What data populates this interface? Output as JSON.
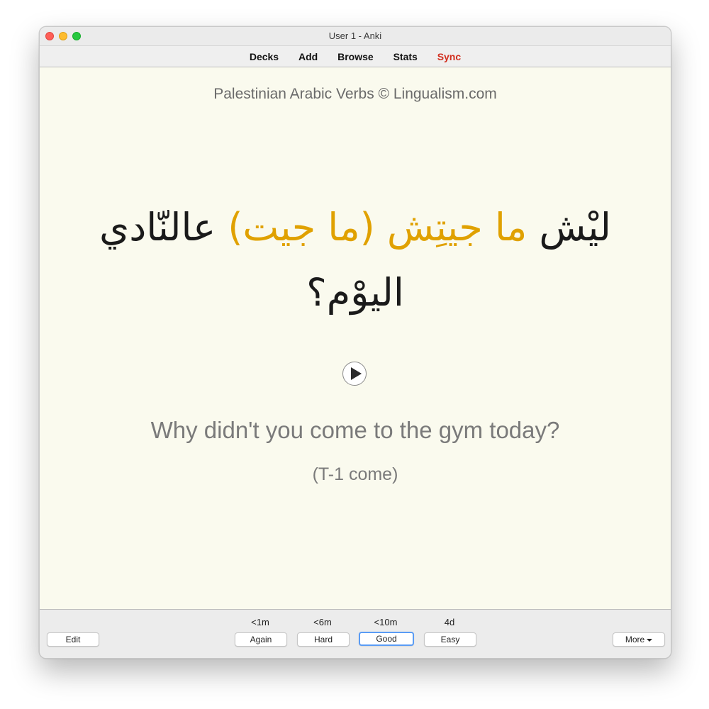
{
  "window": {
    "title": "User 1 - Anki"
  },
  "toolbar": {
    "decks": "Decks",
    "add": "Add",
    "browse": "Browse",
    "stats": "Stats",
    "sync": "Sync",
    "sync_color": "#d22e1e"
  },
  "card": {
    "deck_title": "Palestinian Arabic Verbs © Lingualism.com",
    "arabic_before": "ليْش ",
    "arabic_highlight": "ما جيتِش (ما جيت)",
    "arabic_after": " عالنّادي اليوْم؟",
    "highlight_color": "#e0a100",
    "play_icon": "play-icon",
    "english": "Why didn't you come to the gym today?",
    "note": "(T-1 come)"
  },
  "answer_bar": {
    "edit": "Edit",
    "more": "More",
    "buttons": [
      {
        "label": "Again",
        "interval": "<1m"
      },
      {
        "label": "Hard",
        "interval": "<6m"
      },
      {
        "label": "Good",
        "interval": "<10m"
      },
      {
        "label": "Easy",
        "interval": "4d"
      }
    ]
  }
}
